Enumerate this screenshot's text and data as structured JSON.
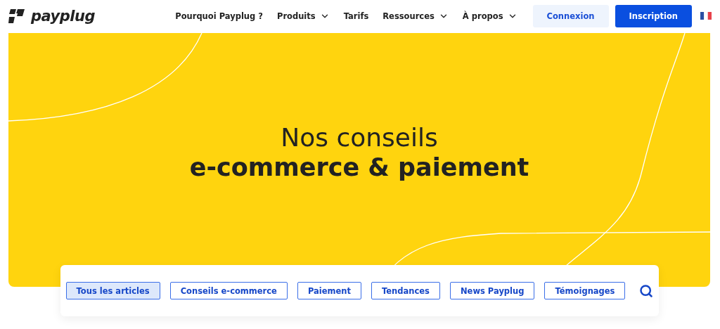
{
  "header": {
    "logo": "payplug",
    "nav": [
      {
        "label": "Pourquoi Payplug ?",
        "dropdown": false
      },
      {
        "label": "Produits",
        "dropdown": true
      },
      {
        "label": "Tarifs",
        "dropdown": false
      },
      {
        "label": "Ressources",
        "dropdown": true
      },
      {
        "label": "À propos",
        "dropdown": true
      }
    ],
    "login": "Connexion",
    "signup": "Inscription"
  },
  "hero": {
    "title": "Nos conseils",
    "subtitle": "e-commerce & paiement"
  },
  "filters": [
    {
      "label": "Tous les articles",
      "selected": true
    },
    {
      "label": "Conseils e-commerce",
      "selected": false
    },
    {
      "label": "Paiement",
      "selected": false
    },
    {
      "label": "Tendances",
      "selected": false
    },
    {
      "label": "News Payplug",
      "selected": false
    },
    {
      "label": "Témoignages",
      "selected": false
    }
  ]
}
